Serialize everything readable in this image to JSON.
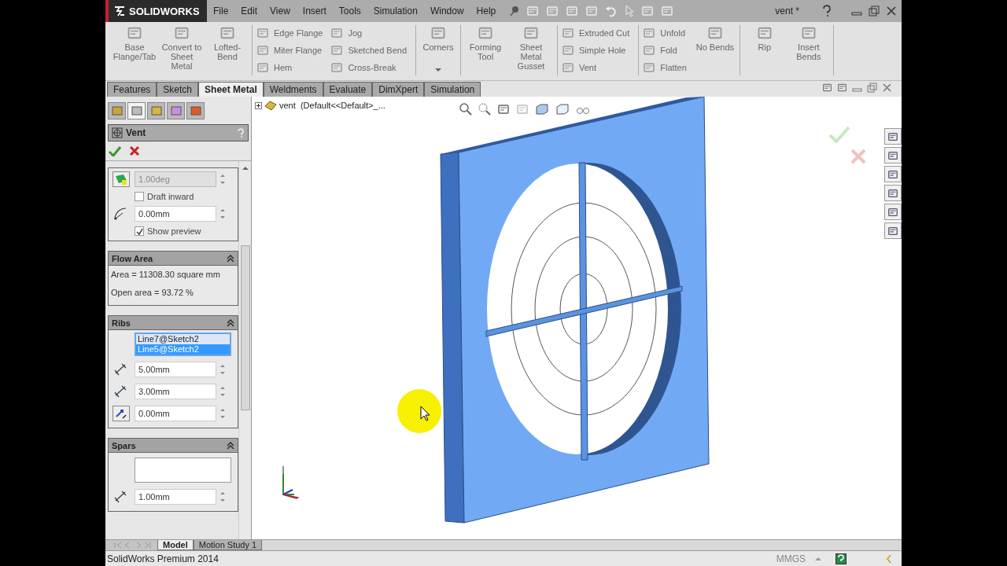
{
  "logo": "SOLIDWORKS",
  "menu": [
    "File",
    "Edit",
    "View",
    "Insert",
    "Tools",
    "Simulation",
    "Window",
    "Help"
  ],
  "document_title": "vent *",
  "ribbon": [
    {
      "items": [
        {
          "kind": "large",
          "label": "Base Flange/Tab"
        },
        {
          "kind": "large",
          "label": "Convert to Sheet Metal"
        },
        {
          "kind": "large",
          "label": "Lofted-Bend"
        }
      ]
    },
    {
      "items": [
        {
          "kind": "small",
          "label": "Edge Flange"
        },
        {
          "kind": "small",
          "label": "Miter Flange"
        },
        {
          "kind": "small",
          "label": "Hem"
        },
        {
          "kind": "small",
          "label": "Jog"
        },
        {
          "kind": "small",
          "label": "Sketched Bend"
        },
        {
          "kind": "small",
          "label": "Cross-Break"
        }
      ]
    },
    {
      "items": [
        {
          "kind": "dropdown",
          "label": "Corners"
        }
      ]
    },
    {
      "items": [
        {
          "kind": "large",
          "label": "Forming Tool"
        },
        {
          "kind": "large",
          "label": "Sheet Metal Gusset"
        }
      ]
    },
    {
      "items": [
        {
          "kind": "small",
          "label": "Extruded Cut"
        },
        {
          "kind": "small",
          "label": "Simple Hole"
        },
        {
          "kind": "small",
          "label": "Vent"
        }
      ]
    },
    {
      "items": [
        {
          "kind": "small",
          "label": "Unfold"
        },
        {
          "kind": "small",
          "label": "Fold"
        },
        {
          "kind": "small",
          "label": "Flatten"
        },
        {
          "kind": "large",
          "label": "No Bends"
        }
      ]
    },
    {
      "items": [
        {
          "kind": "large",
          "label": "Rip"
        },
        {
          "kind": "large",
          "label": "Insert Bends"
        }
      ]
    }
  ],
  "command_tabs": [
    {
      "label": "Features",
      "selected": false
    },
    {
      "label": "Sketch",
      "selected": false
    },
    {
      "label": "Sheet Metal",
      "selected": true
    },
    {
      "label": "Weldments",
      "selected": false
    },
    {
      "label": "Evaluate",
      "selected": false
    },
    {
      "label": "DimXpert",
      "selected": false
    },
    {
      "label": "Simulation",
      "selected": false
    }
  ],
  "property_manager": {
    "tabs": [
      {
        "selected": false
      },
      {
        "selected": true
      },
      {
        "selected": false
      },
      {
        "selected": false
      },
      {
        "selected": false
      }
    ],
    "title": "Vent",
    "draft_angle": {
      "value": "1.00deg",
      "disabled": true
    },
    "draft_inward": {
      "label": "Draft inward",
      "checked": false
    },
    "fillet_radius": {
      "value": "0.00mm"
    },
    "show_preview": {
      "label": "Show preview",
      "checked": true
    },
    "flow_area": {
      "heading": "Flow Area",
      "lines": [
        "Area = 11308.30 square mm",
        "Open area = 93.72 %"
      ]
    },
    "ribs": {
      "heading": "Ribs",
      "entities": [
        {
          "label": "Line7@Sketch2",
          "selected": false
        },
        {
          "label": "Line5@Sketch2",
          "selected": true
        }
      ],
      "depth": "5.00mm",
      "width": "3.00mm",
      "offset": "0.00mm"
    },
    "spars": {
      "heading": "Spars",
      "width": "1.00mm"
    }
  },
  "feature_tree": {
    "root": "vent  (Default<<Default>_...",
    "expanded": false
  },
  "bottom_tabs": [
    {
      "label": "Model",
      "selected": true
    },
    {
      "label": "Motion Study 1",
      "selected": false
    }
  ],
  "status_bar": {
    "product": "SolidWorks Premium 2014",
    "units": "MMGS"
  }
}
